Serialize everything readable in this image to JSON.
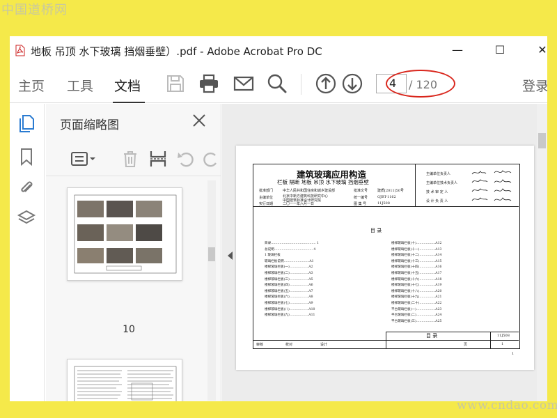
{
  "watermark_top": "中国道桥网",
  "watermark_bottom": "www.cndao.com",
  "window": {
    "title": "地板 吊顶 水下玻璃 挡烟垂壁）.pdf - Adobe Acrobat Pro DC",
    "controls": {
      "minimize": "—",
      "maximize": "☐",
      "close": "✕"
    }
  },
  "menu": {
    "tabs": [
      "主页",
      "工具",
      "文档"
    ],
    "active_tab": "文档",
    "login": "登录"
  },
  "pagenav": {
    "current": "4",
    "total": "/ 120"
  },
  "thumb_panel": {
    "title": "页面缩略图",
    "page_label": "10"
  },
  "document": {
    "title": "建筑玻璃应用构造",
    "subtitle": "栏板  隔断  地板  吊顶  水下玻璃  挡烟垂壁",
    "meta": [
      {
        "label": "批准部门",
        "value": "中华人民共和国住房和城乡建设部",
        "label2": "批准文号",
        "value2": "建质[2011]50号"
      },
      {
        "label": "主编单位",
        "value": "北京中新方建筑科技研究中心",
        "value_b": "中国建筑标准设计研究院",
        "label2": "统一编号",
        "value2": "GJBT-1162"
      },
      {
        "label": "实行日期",
        "value": "二〇一一年六月一日",
        "label2": "图 集 号",
        "value2": "11J508"
      }
    ],
    "signers": [
      "主编单位负责人",
      "主编单位技术负责人",
      "技 术 审 定 人",
      "设 计 负 责 人"
    ],
    "signatures": [
      "刘志红",
      "何乐",
      "顾进",
      "陈伟"
    ],
    "toc_title": "目    录",
    "toc_left": [
      "目录…………………………………… 1",
      "总说明……………………………… 4",
      "1  玻璃栏板",
      "玻璃栏板说明……………………A1",
      "楼梯玻璃栏板(一)………………A2",
      "楼梯玻璃栏板(二)………………A3",
      "楼梯玻璃栏板(三)………………A5",
      "楼梯玻璃栏板(四)………………A6",
      "楼梯玻璃栏板(五)………………A7",
      "楼梯玻璃栏板(六)………………A8",
      "楼梯玻璃栏板(七)………………A9",
      "楼梯玻璃栏板(八)………………A10",
      "楼梯玻璃栏板(九)………………A11"
    ],
    "toc_right": [
      "楼梯玻璃栏板(十)………………A12",
      "楼梯玻璃栏板(十一)……………A13",
      "楼梯玻璃栏板(十二)……………A14",
      "楼梯玻璃栏板(十三)……………A15",
      "楼梯玻璃栏板(十四)……………A16",
      "楼梯玻璃栏板(十五)……………A17",
      "楼梯玻璃栏板(十六)……………A18",
      "楼梯玻璃栏板(十七)……………A19",
      "楼梯玻璃栏板(十八)……………A20",
      "楼梯玻璃栏板(十九)……………A21",
      "楼梯玻璃栏板(二十)……………A22",
      "平台玻璃栏板(一)………………A23",
      "平台玻璃栏板(二)………………A24",
      "平台玻璃栏板(三)………………A25"
    ],
    "footer_title": "目    录",
    "footer_atlas": "11J508",
    "footer_row": [
      "审核",
      "",
      "校对",
      "",
      "设计",
      "",
      "页",
      "1"
    ],
    "page_number": "1"
  },
  "accent_color": "#d9261c"
}
